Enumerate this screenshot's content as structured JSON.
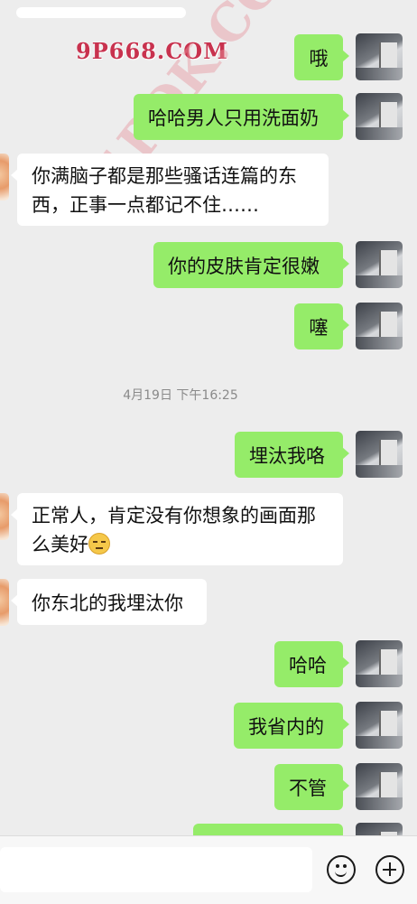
{
  "watermark": {
    "brand": "9P668.COM",
    "diagonal": "91POK.COM"
  },
  "messages": [
    {
      "side": "out",
      "text": "哦"
    },
    {
      "side": "out",
      "text": "哈哈男人只用洗面奶"
    },
    {
      "side": "in",
      "line1": "你满脑子都是那些骚话连篇的东",
      "line2": "西，正事一点都记不住……"
    },
    {
      "side": "out",
      "text": "你的皮肤肯定很嫩"
    },
    {
      "side": "out",
      "text": "噻"
    },
    {
      "timestamp": "4月19日 下午16:25"
    },
    {
      "side": "out",
      "text": "埋汰我咯"
    },
    {
      "side": "in",
      "line1": "正常人，肯定没有你想象的画面那",
      "line2": "么美好",
      "emoji": "smirk-emoji"
    },
    {
      "side": "in",
      "text": "你东北的我埋汰你"
    },
    {
      "side": "out",
      "text": "哈哈"
    },
    {
      "side": "out",
      "text": "我省内的"
    },
    {
      "side": "out",
      "text": "不管"
    },
    {
      "side": "out",
      "text": ""
    }
  ],
  "input_bar": {
    "placeholder": "",
    "emoji_button_icon": "smile-icon",
    "more_button_icon": "plus-icon"
  }
}
